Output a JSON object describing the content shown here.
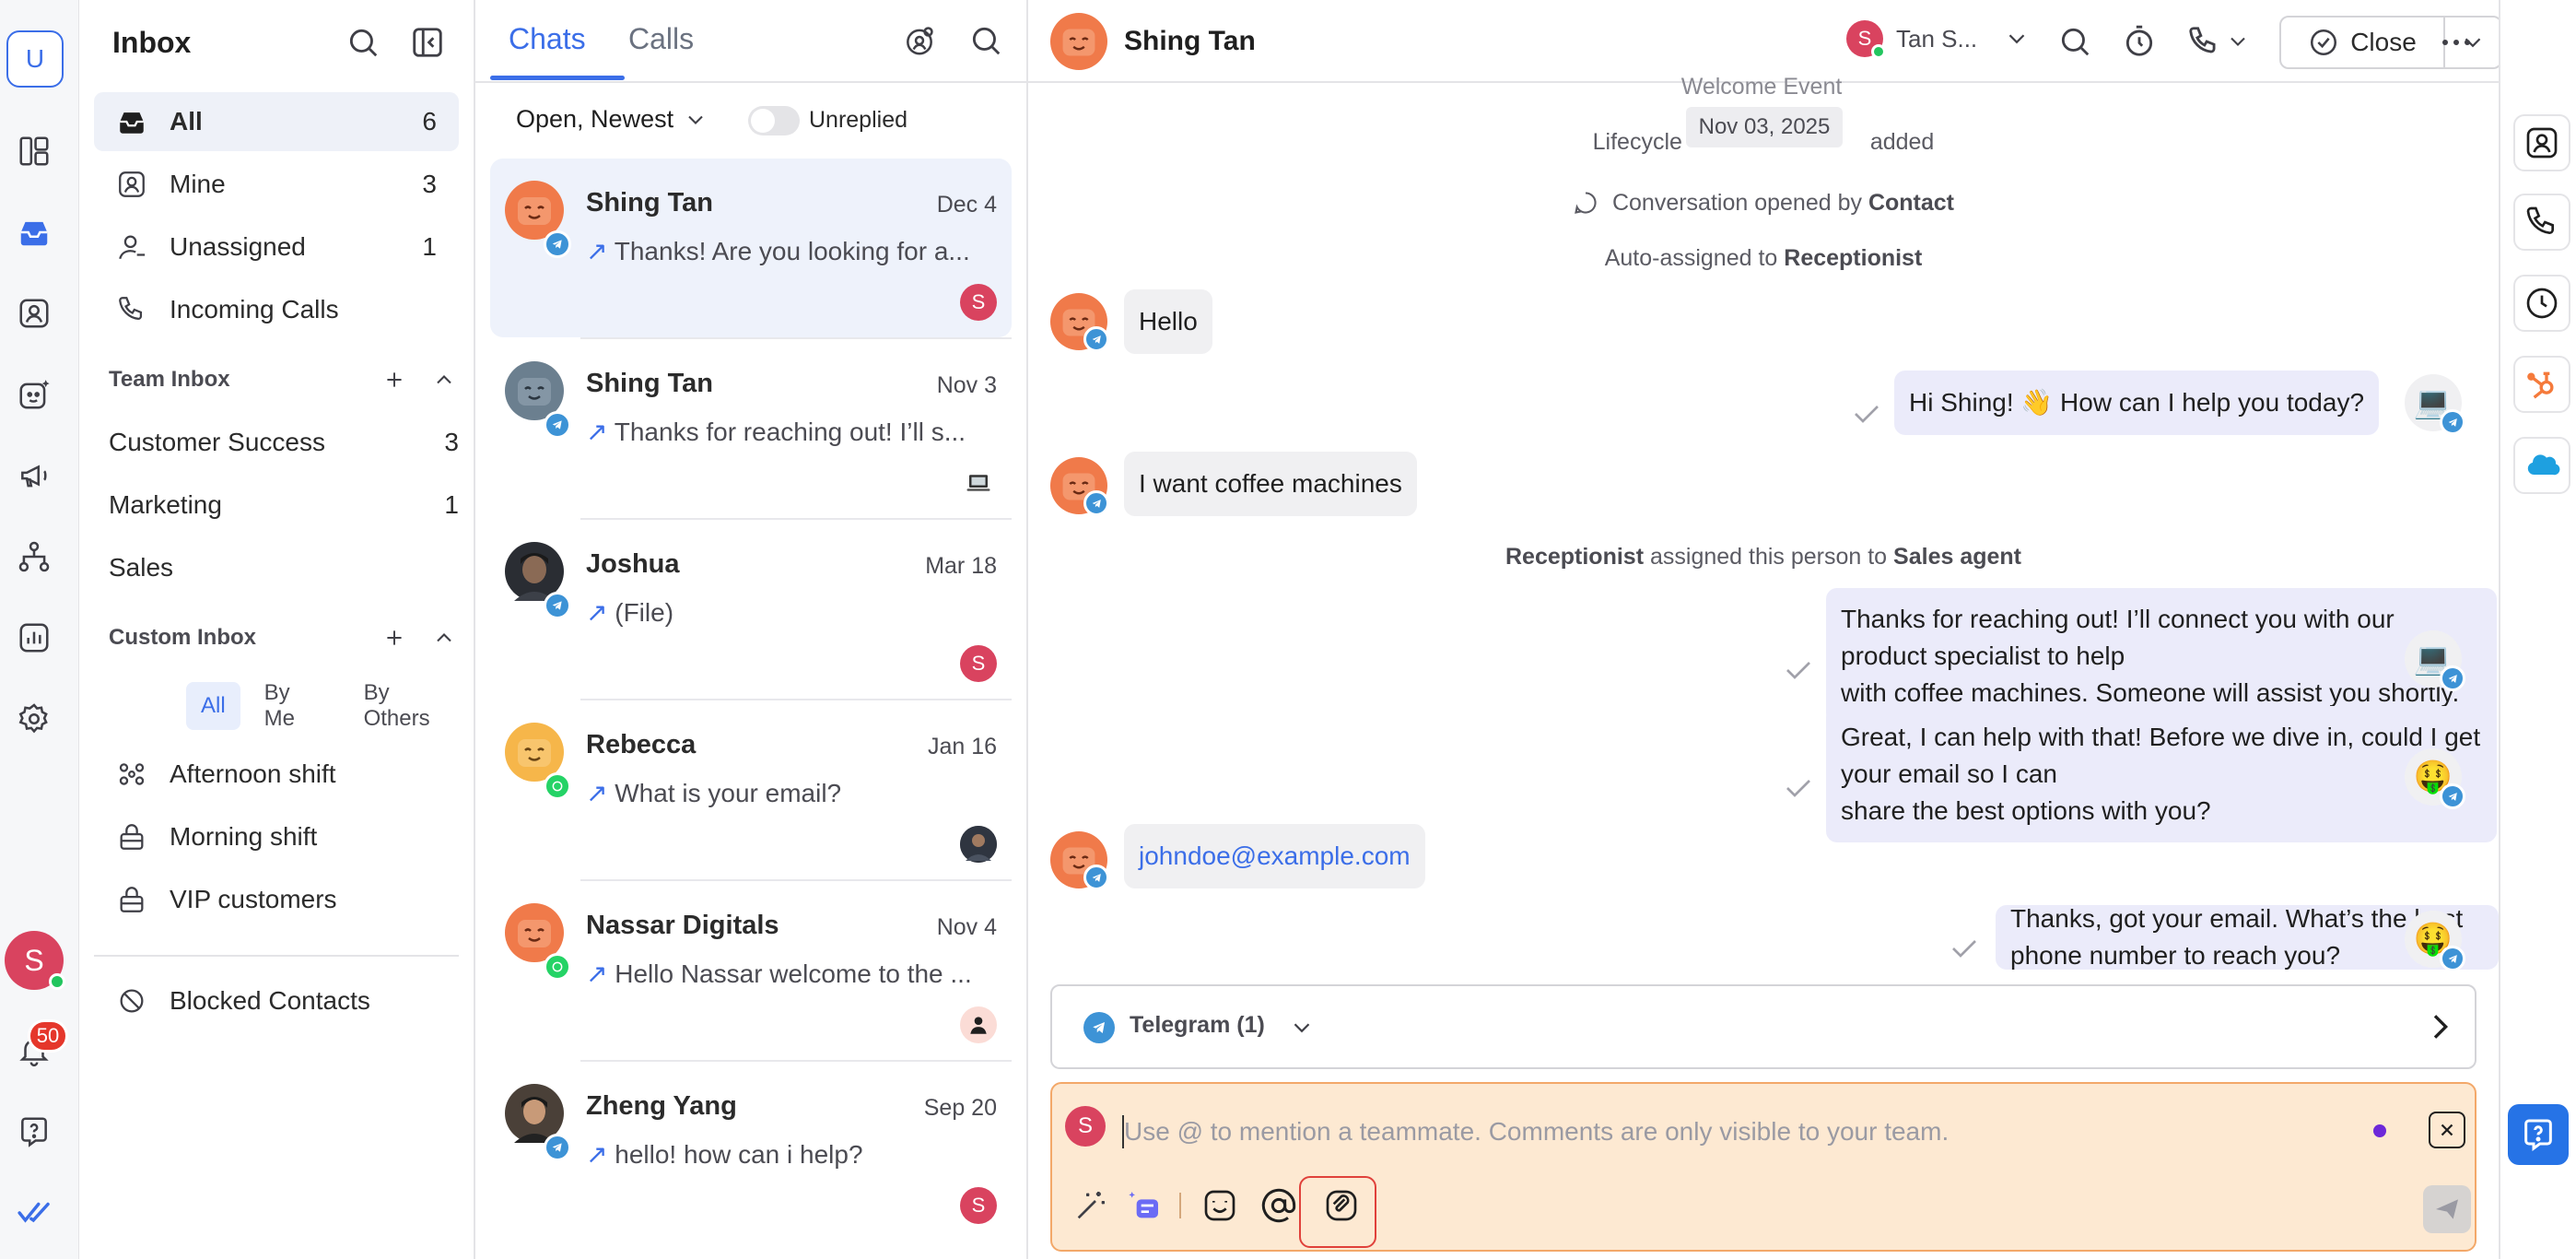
{
  "rail": {
    "workspace_initial": "U",
    "icons": [
      "layout-icon",
      "inbox-icon",
      "contacts-icon",
      "ai-agent-icon",
      "broadcast-icon",
      "workflow-icon",
      "reports-icon",
      "settings-icon"
    ],
    "user_initial": "S",
    "notification_count": "50"
  },
  "inbox": {
    "title": "Inbox",
    "items": [
      {
        "label": "All",
        "count": "6"
      },
      {
        "label": "Mine",
        "count": "3"
      },
      {
        "label": "Unassigned",
        "count": "1"
      },
      {
        "label": "Incoming Calls",
        "count": ""
      }
    ],
    "team_inbox": {
      "title": "Team Inbox",
      "items": [
        {
          "label": "Customer Success",
          "count": "3"
        },
        {
          "label": "Marketing",
          "count": "1"
        },
        {
          "label": "Sales",
          "count": ""
        }
      ]
    },
    "custom_inbox": {
      "title": "Custom Inbox",
      "filters": [
        "All",
        "By Me",
        "By Others"
      ],
      "items": [
        {
          "label": "Afternoon shift"
        },
        {
          "label": "Morning shift"
        },
        {
          "label": "VIP customers"
        }
      ]
    },
    "blocked": "Blocked Contacts"
  },
  "chatlist": {
    "tabs": [
      "Chats",
      "Calls"
    ],
    "filter": "Open, Newest",
    "unreplied": "Unreplied",
    "conversations": [
      {
        "name": "Shing Tan",
        "date": "Dec 4",
        "preview": "Thanks! Are you looking for a...",
        "channel": "telegram",
        "assignee": "S"
      },
      {
        "name": "Shing Tan",
        "date": "Nov 3",
        "preview": "Thanks for reaching out! I’ll s...",
        "channel": "telegram",
        "assignee": "laptop"
      },
      {
        "name": "Joshua",
        "date": "Mar 18",
        "preview": "(File)",
        "channel": "telegram",
        "assignee": "S"
      },
      {
        "name": "Rebecca",
        "date": "Jan 16",
        "preview": "What is your email?",
        "channel": "whatsapp",
        "assignee": "photo"
      },
      {
        "name": "Nassar Digitals",
        "date": "Nov 4",
        "preview": "Hello Nassar welcome to the ...",
        "channel": "whatsapp",
        "assignee": "person"
      },
      {
        "name": "Zheng Yang",
        "date": "Sep 20",
        "preview": "hello! how can i help?",
        "channel": "telegram",
        "assignee": "S"
      }
    ]
  },
  "chat": {
    "contact_name": "Shing Tan",
    "assignee_short": "Tan S...",
    "assignee_initial": "S",
    "close_label": "Close",
    "system": {
      "welcome": "Welcome Event",
      "date_chip": "Nov 03, 2025",
      "lifecycle_pre": "Lifecycle",
      "lifecycle_post": "added",
      "opened_text": "Conversation opened by",
      "opened_by": "Contact",
      "auto_text": "Auto-assigned to",
      "auto_to": "Receptionist",
      "assign_from": "Receptionist",
      "assign_text": "assigned this person to",
      "assign_to": "Sales agent"
    },
    "messages": {
      "m1": "Hello",
      "m2": "Hi Shing! 👋 How can I help you today?",
      "m3": "I want coffee machines",
      "m4a": "Thanks for reaching out! I’ll connect you with our product specialist to help",
      "m4b": "with coffee machines. Someone will assist you shortly.",
      "m5a": "Great, I can help with that! Before we dive in, could I get your email so I can",
      "m5b": "share the best options with you?",
      "m6": "johndoe@example.com",
      "m7": "Thanks, got your email. What’s the best phone number to reach you?"
    },
    "agent_emoji": {
      "bot_laptop": "💻",
      "money_face": "🤑"
    },
    "channel_selector": "Telegram (1)",
    "compose_placeholder": "Use @ to mention a teammate. Comments are only visible to your team.",
    "compose_user": "S"
  },
  "colors": {
    "accent": "#3b6ee8",
    "brand_orange": "#f07a4a",
    "telegram": "#3d93d6",
    "whatsapp": "#25d366",
    "user_pink": "#d9435f",
    "compose_bg": "#fde9d2",
    "highlight": "#e0413b"
  }
}
